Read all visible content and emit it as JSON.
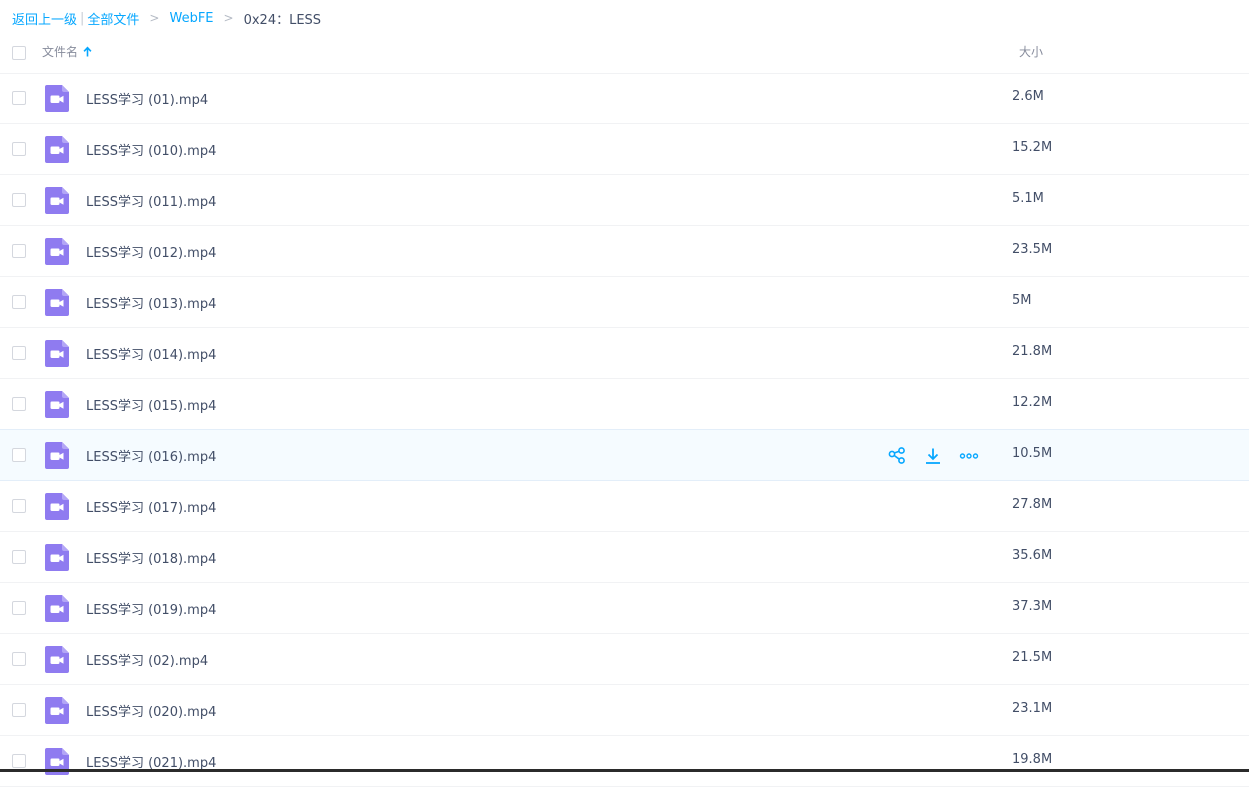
{
  "breadcrumb": {
    "back_label": "返回上一级",
    "all_files_label": "全部文件",
    "folder_label": "WebFE",
    "current_label": "0x24：LESS",
    "separator": ">"
  },
  "header": {
    "name_column": "文件名",
    "size_column": "大小",
    "sort_icon": "arrow-up-icon"
  },
  "file_icon": "video-file-icon",
  "actions": {
    "share_icon": "share-icon",
    "download_icon": "download-icon",
    "more_icon": "more-icon"
  },
  "files": [
    {
      "name": "LESS学习 (01).mp4",
      "size": "2.6M"
    },
    {
      "name": "LESS学习 (010).mp4",
      "size": "15.2M"
    },
    {
      "name": "LESS学习 (011).mp4",
      "size": "5.1M"
    },
    {
      "name": "LESS学习 (012).mp4",
      "size": "23.5M"
    },
    {
      "name": "LESS学习 (013).mp4",
      "size": "5M"
    },
    {
      "name": "LESS学习 (014).mp4",
      "size": "21.8M"
    },
    {
      "name": "LESS学习 (015).mp4",
      "size": "12.2M"
    },
    {
      "name": "LESS学习 (016).mp4",
      "size": "10.5M",
      "hovered": true
    },
    {
      "name": "LESS学习 (017).mp4",
      "size": "27.8M"
    },
    {
      "name": "LESS学习 (018).mp4",
      "size": "35.6M"
    },
    {
      "name": "LESS学习 (019).mp4",
      "size": "37.3M"
    },
    {
      "name": "LESS学习 (02).mp4",
      "size": "21.5M"
    },
    {
      "name": "LESS学习 (020).mp4",
      "size": "23.1M"
    },
    {
      "name": "LESS学习 (021).mp4",
      "size": "19.8M"
    }
  ],
  "colors": {
    "accent": "#06a7ff",
    "video_icon": "#8f7bf0",
    "hover_row": "#f5fbff",
    "text": "#424e67",
    "muted": "#878c9c"
  }
}
